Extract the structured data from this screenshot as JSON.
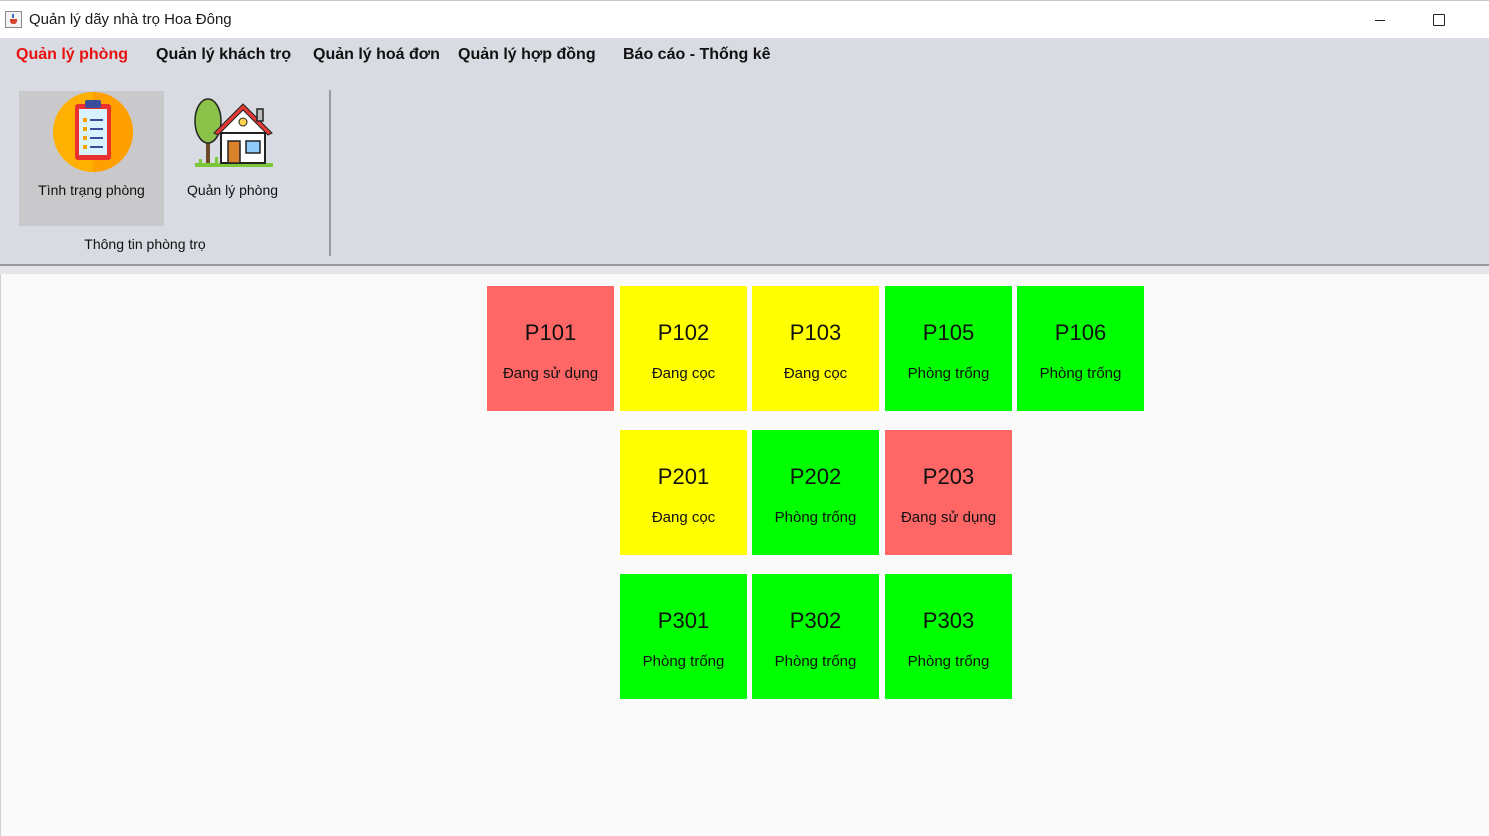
{
  "window": {
    "title": "Quản lý dãy nhà trọ Hoa Đông"
  },
  "menu": [
    {
      "label": "Quản lý phòng",
      "active": true
    },
    {
      "label": "Quản lý khách trọ",
      "active": false
    },
    {
      "label": "Quản lý hoá đơn",
      "active": false
    },
    {
      "label": "Quản lý hợp đồng",
      "active": false
    },
    {
      "label": "Báo cáo - Thống kê",
      "active": false
    }
  ],
  "ribbon": {
    "group_label": "Thông tin phòng trọ",
    "buttons": [
      {
        "label": "Tình trạng phòng",
        "icon": "clipboard-list-icon",
        "selected": true
      },
      {
        "label": "Quản lý phòng",
        "icon": "house-tree-icon",
        "selected": false
      }
    ]
  },
  "colors": {
    "occupied": "#ff6666",
    "deposited": "#ffff00",
    "vacant": "#00ff00",
    "active_menu": "#e81010"
  },
  "rooms": [
    {
      "code": "P101",
      "status": "Đang sử dụng",
      "state": "occupied"
    },
    {
      "code": "P102",
      "status": "Đang cọc",
      "state": "deposited"
    },
    {
      "code": "P103",
      "status": "Đang cọc",
      "state": "deposited"
    },
    {
      "code": "P105",
      "status": "Phòng trống",
      "state": "vacant"
    },
    {
      "code": "P106",
      "status": "Phòng trống",
      "state": "vacant"
    },
    {
      "code": "P201",
      "status": "Đang cọc",
      "state": "deposited"
    },
    {
      "code": "P202",
      "status": "Phòng trống",
      "state": "vacant"
    },
    {
      "code": "P203",
      "status": "Đang sử dụng",
      "state": "occupied"
    },
    {
      "code": "P301",
      "status": "Phòng trống",
      "state": "vacant"
    },
    {
      "code": "P302",
      "status": "Phòng trống",
      "state": "vacant"
    },
    {
      "code": "P303",
      "status": "Phòng trống",
      "state": "vacant"
    }
  ]
}
